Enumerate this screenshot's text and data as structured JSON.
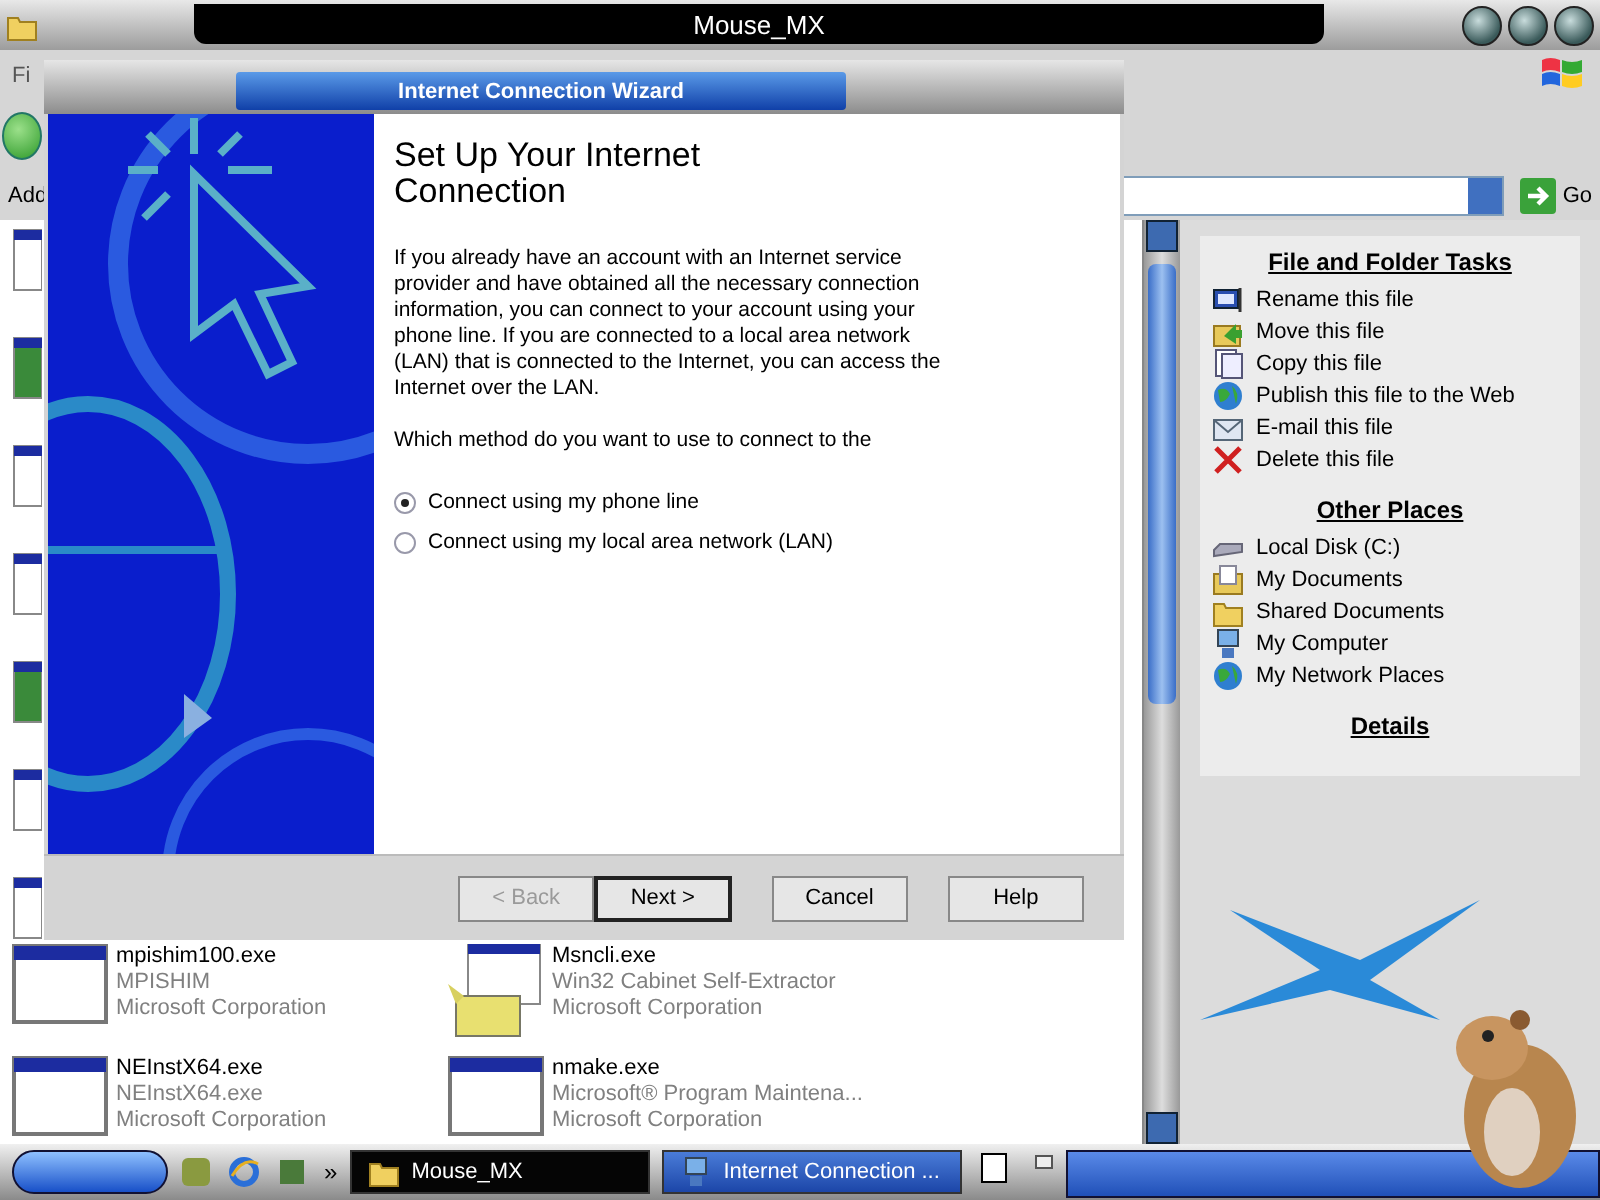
{
  "explorer": {
    "title": "Mouse_MX",
    "menu": [
      "Fi"
    ],
    "address_label": "Add",
    "go": "Go",
    "files": [
      {
        "name": "mpishim100.exe",
        "description": "MPISHIM",
        "company": "Microsoft Corporation",
        "kind": "window"
      },
      {
        "name": "Msncli.exe",
        "description": "Win32 Cabinet Self-Extractor",
        "company": "Microsoft Corporation",
        "kind": "cabinet"
      },
      {
        "name": "NEInstX64.exe",
        "description": "NEInstX64.exe",
        "company": "Microsoft Corporation",
        "kind": "window"
      },
      {
        "name": "nmake.exe",
        "description": "Microsoft® Program Maintena...",
        "company": "Microsoft Corporation",
        "kind": "window"
      }
    ],
    "task_sections": [
      {
        "title": "File and Folder Tasks",
        "items": [
          {
            "label": "Rename this file",
            "kind": "rename"
          },
          {
            "label": "Move this file",
            "kind": "move"
          },
          {
            "label": "Copy this file",
            "kind": "copy"
          },
          {
            "label": "Publish this file to the Web",
            "kind": "globe"
          },
          {
            "label": "E-mail this file",
            "kind": "mail"
          },
          {
            "label": "Delete this file",
            "kind": "delete"
          }
        ]
      },
      {
        "title": "Other Places",
        "items": [
          {
            "label": "Local Disk (C:)",
            "kind": "disk"
          },
          {
            "label": "My Documents",
            "kind": "documents"
          },
          {
            "label": "Shared Documents",
            "kind": "folder"
          },
          {
            "label": "My Computer",
            "kind": "computer"
          },
          {
            "label": "My Network Places",
            "kind": "globe"
          }
        ]
      },
      {
        "title": "Details"
      }
    ]
  },
  "wizard": {
    "title": "Internet Connection Wizard",
    "heading": "Set Up Your Internet Connection",
    "body": "If you already have an account with an Internet service provider and have obtained all the necessary connection information, you can connect to your account using your phone line. If you are connected to a local area network (LAN) that is connected to the Internet, you can access the Internet over the LAN.",
    "question": "Which method do you want to use to connect to the",
    "options": [
      {
        "label": "Connect using my phone line",
        "selected": true
      },
      {
        "label": "Connect using my local area network (LAN)",
        "selected": false
      }
    ],
    "buttons": [
      {
        "label": "< Back",
        "disabled": true,
        "default": false
      },
      {
        "label": "Next >",
        "disabled": false,
        "default": true
      },
      {
        "label": "Cancel",
        "disabled": false,
        "default": false
      },
      {
        "label": "Help",
        "disabled": false,
        "default": false
      }
    ]
  },
  "taskbar": {
    "overflow": "»",
    "tasks": [
      {
        "label": "Mouse_MX",
        "selected": false,
        "kind": "folder"
      },
      {
        "label": "Internet Connection ...",
        "selected": true,
        "kind": "wizard"
      }
    ]
  }
}
